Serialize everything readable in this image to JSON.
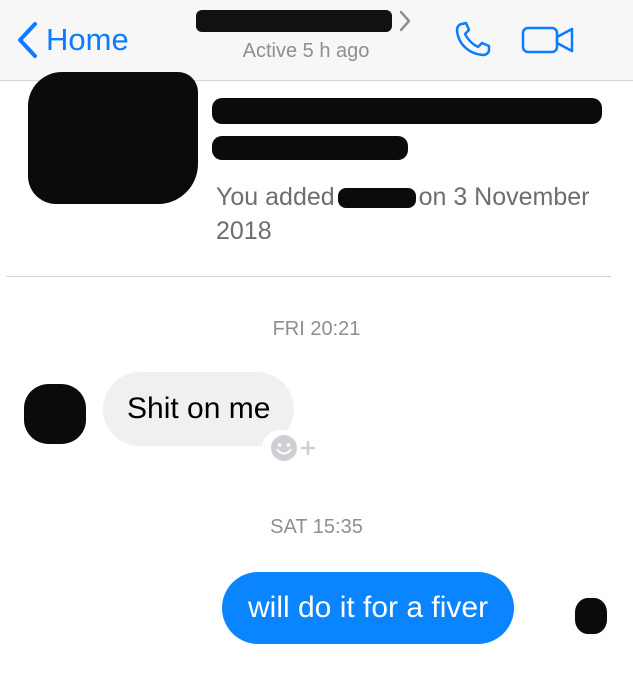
{
  "nav": {
    "back_label": "Home",
    "status": "Active 5 h ago"
  },
  "profile": {
    "added_prefix": "You added",
    "added_suffix": "on 3 November 2018"
  },
  "messages": [
    {
      "type": "timestamp",
      "text": "FRI 20:21"
    },
    {
      "type": "incoming",
      "text": "Shit on me"
    },
    {
      "type": "timestamp",
      "text": "SAT 15:35"
    },
    {
      "type": "outgoing",
      "text": "will do it for a fiver"
    }
  ],
  "colors": {
    "accent": "#0a7cff",
    "outgoing_bubble": "#0a84ff",
    "incoming_bubble": "#f0f0f0",
    "muted_text": "#8e8e93",
    "redaction": "#0b0b0b"
  },
  "icons": {
    "back": "chevron-left-icon",
    "call": "phone-icon",
    "video": "video-camera-icon",
    "react": "add-reaction-icon"
  }
}
